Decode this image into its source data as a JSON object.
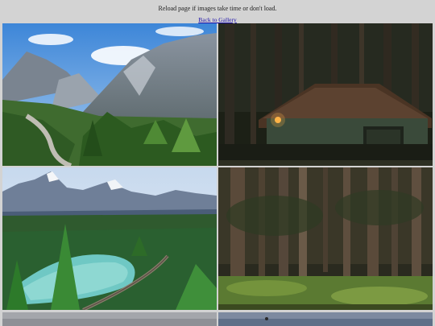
{
  "header": {
    "notice": "Reload page if images take time or don't load.",
    "back_link": "Back to Gallery"
  },
  "gallery": {
    "images": [
      {
        "subject": "mountain-valley-road"
      },
      {
        "subject": "forest-cabin-night"
      },
      {
        "subject": "mountain-lake-railway"
      },
      {
        "subject": "pine-forest"
      },
      {
        "subject": "partial-image"
      },
      {
        "subject": "partial-image"
      }
    ]
  }
}
